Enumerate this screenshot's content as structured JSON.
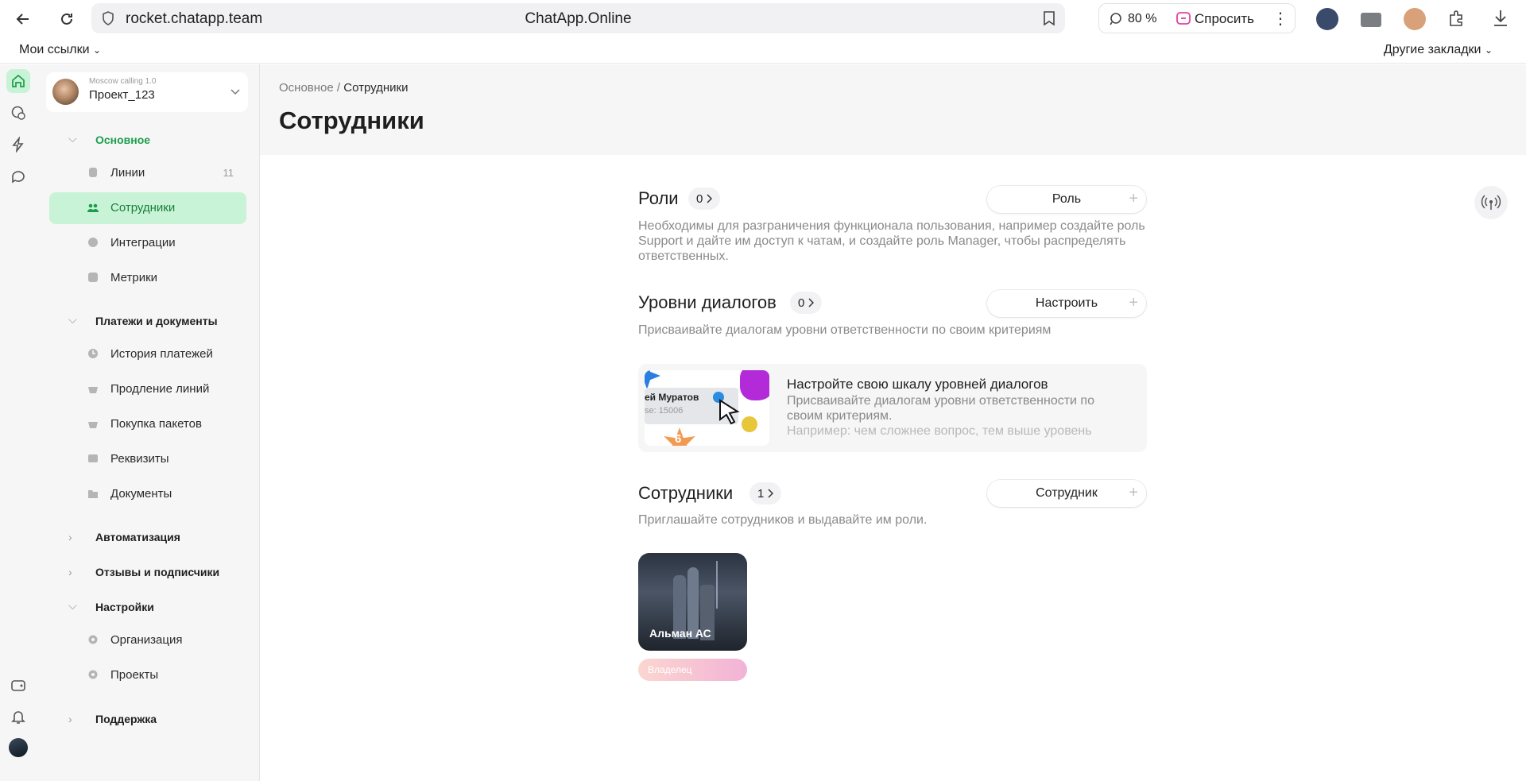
{
  "browser": {
    "url": "rocket.chatapp.team",
    "title": "ChatApp.Online",
    "zoom": "80 %",
    "ask_label": "Спросить",
    "bookmarks": {
      "my_links": "Мои ссылки",
      "other": "Другие закладки"
    }
  },
  "sidebar": {
    "project_sub": "Moscow calling 1.0",
    "project_name": "Проект_123",
    "sections": {
      "main": "Основное",
      "payments": "Платежи и документы",
      "automation": "Автоматизация",
      "reviews": "Отзывы и подписчики",
      "settings": "Настройки",
      "support": "Поддержка"
    },
    "items": {
      "lines": "Линии",
      "lines_count": "11",
      "employees": "Сотрудники",
      "integrations": "Интеграции",
      "metrics": "Метрики",
      "payment_history": "История платежей",
      "renew_lines": "Продление линий",
      "buy_packages": "Покупка пакетов",
      "requisites": "Реквизиты",
      "documents": "Документы",
      "organization": "Организация",
      "projects": "Проекты"
    }
  },
  "main": {
    "breadcrumb_root": "Основное",
    "breadcrumb_sep": " / ",
    "breadcrumb_current": "Сотрудники",
    "title": "Сотрудники",
    "roles": {
      "title": "Роли",
      "count": "0",
      "button": "Роль",
      "desc": "Необходимы для разграничения функционала пользования, например создайте роль Support и дайте им доступ к чатам, и создайте роль Manager, чтобы распределять ответственных."
    },
    "levels": {
      "title": "Уровни диалогов",
      "count": "0",
      "button": "Настроить",
      "desc": "Присваивайте диалогам уровни ответственности по своим критериям"
    },
    "promo": {
      "title": "Настройте свою шкалу уровней диалогов",
      "desc": "Присваивайте диалогам уровни ответственности по своим критериям.",
      "example": "Например: чем сложнее вопрос, тем выше уровень",
      "img_name": "ей Муратов",
      "img_sub": "se: 15006",
      "img_num": "6"
    },
    "employees": {
      "title": "Сотрудники",
      "count": "1",
      "button": "Сотрудник",
      "desc": "Приглашайте сотрудников и выдавайте им роли.",
      "card_name": "Альман АС",
      "badge": "Владелец"
    }
  },
  "colors": {
    "accent": "#1a9e4b",
    "active_bg": "#c9f3d6"
  }
}
